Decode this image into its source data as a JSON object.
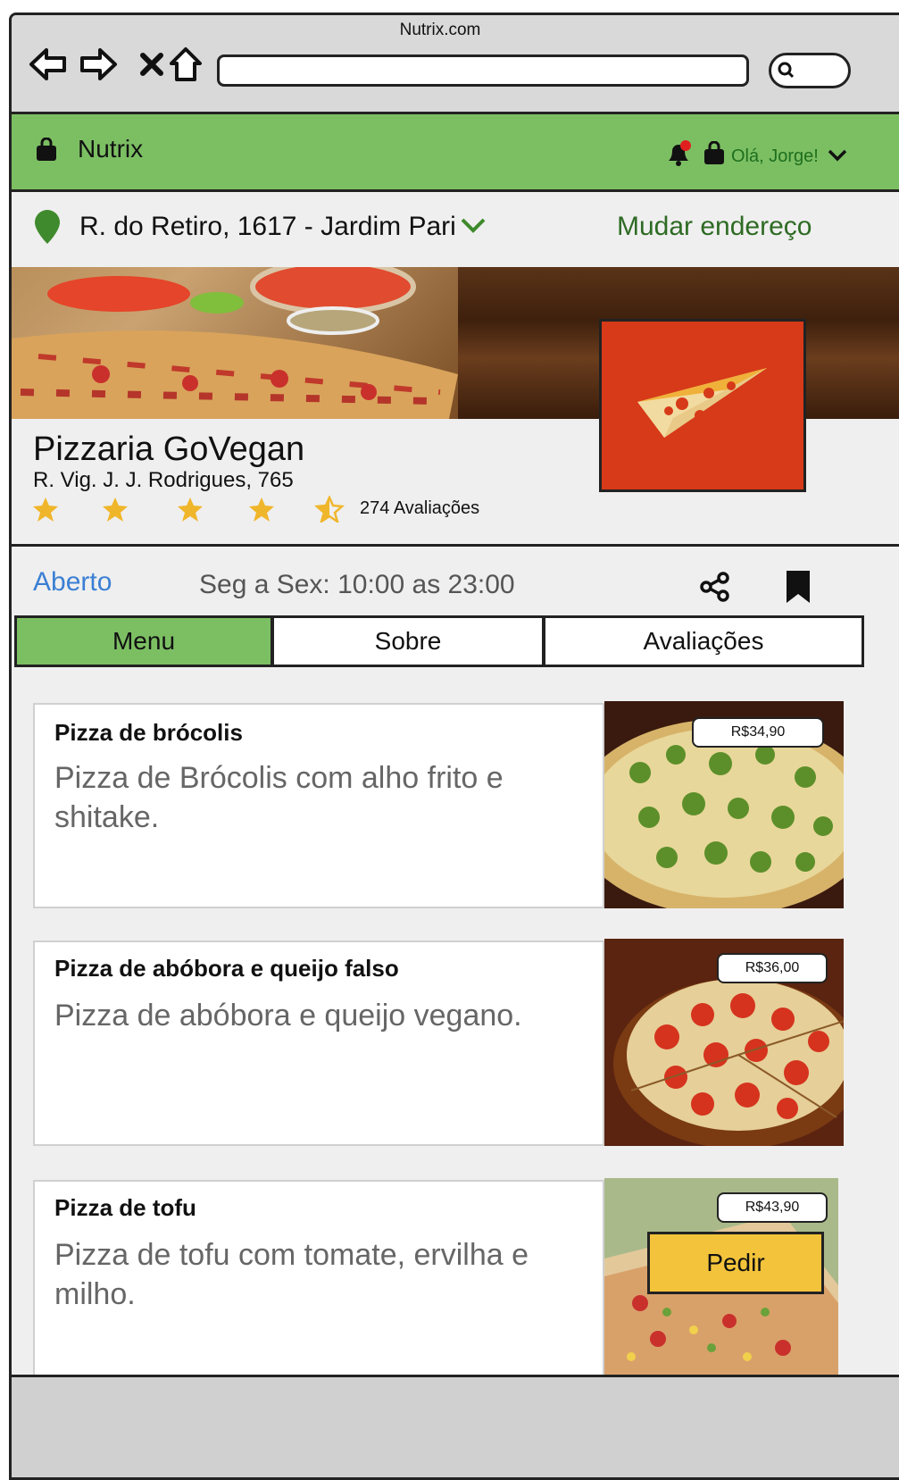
{
  "browser": {
    "site_title": "Nutrix.com"
  },
  "header": {
    "brand": "Nutrix",
    "greeting": "Olá, Jorge!"
  },
  "address": {
    "text": "R. do Retiro, 1617 - Jardim Pari",
    "change_label": "Mudar endereço"
  },
  "restaurant": {
    "name": "Pizzaria GoVegan",
    "address": "R. Vig. J. J. Rodrigues, 765",
    "rating": 4.5,
    "reviews_label": "274 Avaliações",
    "status": "Aberto",
    "hours": "Seg a Sex: 10:00 as 23:00"
  },
  "tabs": [
    {
      "label": "Menu",
      "active": true
    },
    {
      "label": "Sobre",
      "active": false
    },
    {
      "label": "Avaliações",
      "active": false
    }
  ],
  "menu": [
    {
      "title": "Pizza de brócolis",
      "description": "Pizza de Brócolis com alho frito e shitake.",
      "price": "R$34,90"
    },
    {
      "title": "Pizza de abóbora e queijo falso",
      "description": "Pizza de abóbora e queijo vegano.",
      "price": "R$36,00"
    },
    {
      "title": "Pizza de tofu",
      "description": "Pizza de tofu com tomate, ervilha e milho.",
      "price": "R$43,90",
      "order_label": "Pedir"
    }
  ],
  "colors": {
    "header_green": "#7cbf63",
    "open_blue": "#3b7fd4",
    "order_yellow": "#f3c43b",
    "logo_red": "#d63a18"
  }
}
